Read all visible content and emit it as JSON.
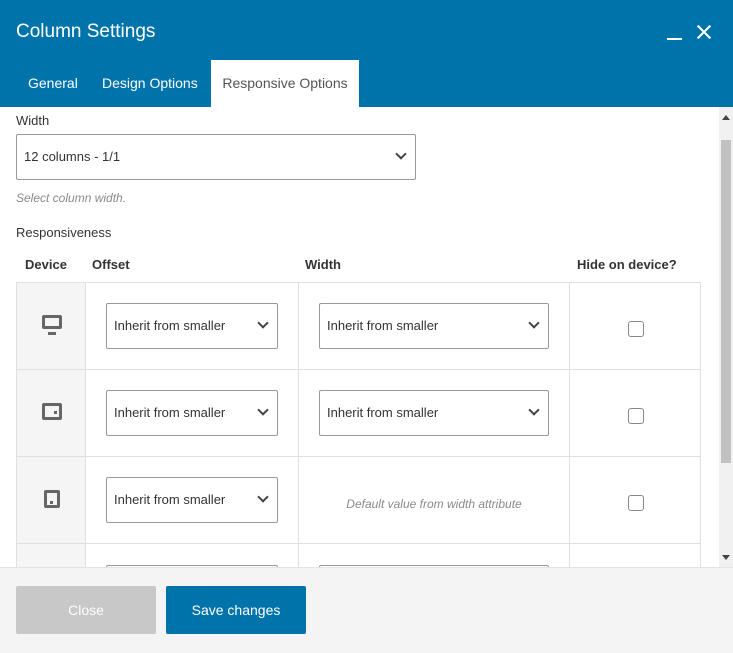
{
  "window": {
    "title": "Column Settings",
    "minimize_icon": "minimize-icon",
    "close_icon": "close-icon"
  },
  "tabs": [
    {
      "label": "General",
      "active": false
    },
    {
      "label": "Design Options",
      "active": false
    },
    {
      "label": "Responsive Options",
      "active": true
    }
  ],
  "width_section": {
    "label": "Width",
    "selected": "12 columns - 1/1",
    "hint": "Select column width."
  },
  "responsiveness": {
    "label": "Responsiveness",
    "headers": {
      "device": "Device",
      "offset": "Offset",
      "width": "Width",
      "hide": "Hide on device?"
    },
    "rows": [
      {
        "device_icon": "desktop-icon",
        "offset": "Inherit from smaller",
        "width": "Inherit from smaller",
        "hidden": false
      },
      {
        "device_icon": "tablet-landscape-icon",
        "offset": "Inherit from smaller",
        "width": "Inherit from smaller",
        "hidden": false
      },
      {
        "device_icon": "tablet-portrait-icon",
        "offset": "Inherit from smaller",
        "width_text": "Default value from width attribute",
        "hidden": false
      }
    ]
  },
  "footer": {
    "close_label": "Close",
    "save_label": "Save changes"
  },
  "colors": {
    "accent": "#0073aa",
    "disabled_button": "#c8c8c8"
  }
}
